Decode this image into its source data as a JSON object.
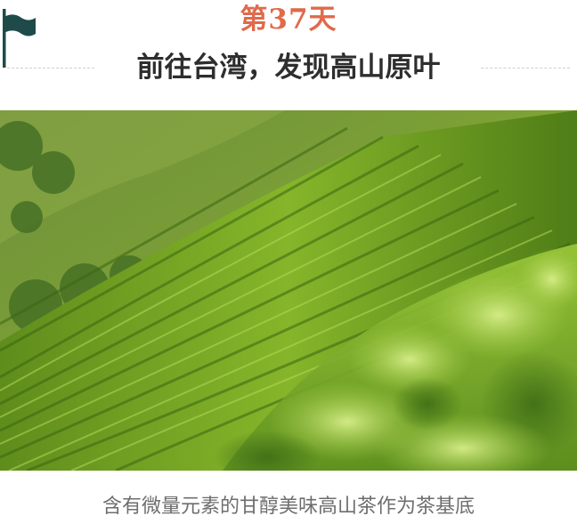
{
  "header": {
    "day_label": "第37天",
    "title": "前往台湾，发现高山原叶"
  },
  "photo": {
    "subject": "tea-plantation-photo"
  },
  "caption": "含有微量元素的甘醇美味高山茶作为茶基底",
  "colors": {
    "accent": "#e06a4b",
    "flag": "#1f4a4a",
    "title": "#2e2e2e",
    "caption": "#6e6e6e"
  }
}
